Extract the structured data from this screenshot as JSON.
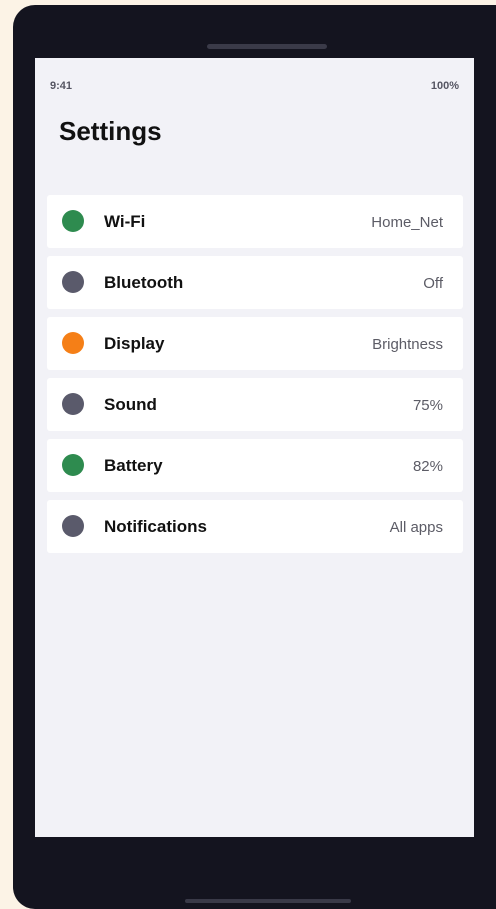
{
  "status_bar": {
    "time": "9:41",
    "battery": "100%"
  },
  "header": {
    "title": "Settings"
  },
  "settings": [
    {
      "label": "Wi-Fi",
      "value": "Home_Net",
      "dot_color": "#2e8b4f",
      "icon": "wifi-status-dot-icon"
    },
    {
      "label": "Bluetooth",
      "value": "Off",
      "dot_color": "#5a5a6b",
      "icon": "bluetooth-status-dot-icon"
    },
    {
      "label": "Display",
      "value": "Brightness",
      "dot_color": "#f57f17",
      "icon": "display-status-dot-icon"
    },
    {
      "label": "Sound",
      "value": "75%",
      "dot_color": "#5a5a6b",
      "icon": "sound-status-dot-icon"
    },
    {
      "label": "Battery",
      "value": "82%",
      "dot_color": "#2e8b4f",
      "icon": "battery-status-dot-icon"
    },
    {
      "label": "Notifications",
      "value": "All apps",
      "dot_color": "#5a5a6b",
      "icon": "notifications-status-dot-icon"
    }
  ]
}
